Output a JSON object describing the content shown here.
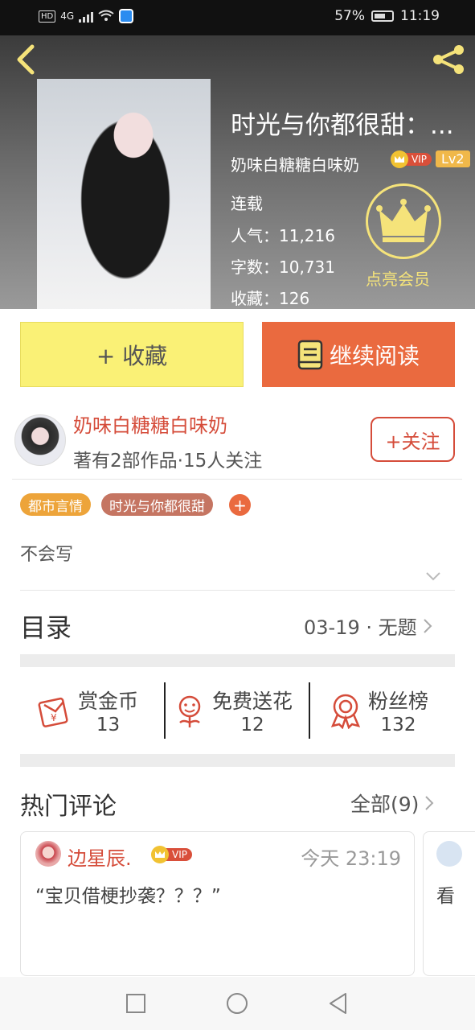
{
  "status_bar": {
    "network": "4G",
    "hd": "HD",
    "battery": "57%",
    "time": "11:19"
  },
  "book": {
    "title": "时光与你都很甜：...",
    "author": "奶味白糖糖白味奶",
    "vip_label": "VIP",
    "level": "Lv2",
    "status": "连载",
    "popularity": "人气：11,216",
    "word_count": "字数：10,731",
    "favorites": "收藏：126",
    "member_label": "点亮会员"
  },
  "actions": {
    "collect": "+ 收藏",
    "continue_read": "继续阅读"
  },
  "author_row": {
    "name": "奶味白糖糖白味奶",
    "stats": "著有2部作品·15人关注",
    "follow": "+关注"
  },
  "tags": [
    "都市言情",
    "时光与你都很甜"
  ],
  "tag_add": "+",
  "intro": "不会写",
  "catalog": {
    "title": "目录",
    "latest": "03-19 · 无题"
  },
  "stats": [
    {
      "label": "赏金币",
      "value": "13",
      "icon": "red-envelope-icon"
    },
    {
      "label": "免费送花",
      "value": "12",
      "icon": "flower-icon"
    },
    {
      "label": "粉丝榜",
      "value": "132",
      "icon": "medal-icon"
    }
  ],
  "comments": {
    "title": "热门评论",
    "all_link": "全部(9)",
    "items": [
      {
        "user": "边星辰.",
        "vip": "VIP",
        "time": "今天 23:19",
        "text": "“宝贝借梗抄袭？？？”"
      },
      {
        "text": "看"
      }
    ]
  },
  "colors": {
    "accent": "#ea6a3f",
    "author_red": "#d54c3a",
    "collect_yellow": "#faf176",
    "gold": "#f5e37a"
  }
}
